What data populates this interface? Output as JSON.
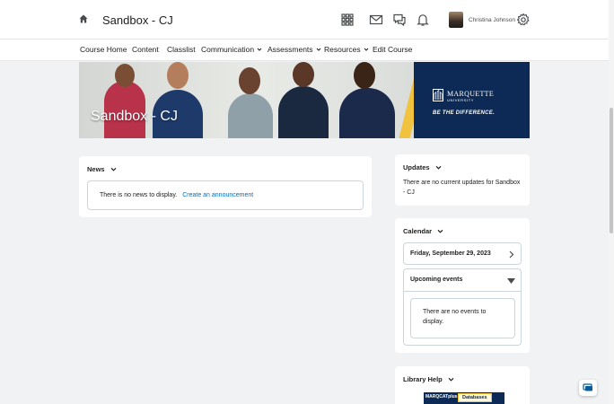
{
  "header": {
    "site_title": "Sandbox - CJ",
    "user_name": "Christina Johnson",
    "icons": [
      "home-icon",
      "waffle-icon",
      "email-icon",
      "discussions-icon",
      "notifications-icon",
      "settings-icon"
    ]
  },
  "nav": {
    "items": [
      {
        "label": "Course Home",
        "dropdown": false
      },
      {
        "label": "Content",
        "dropdown": false
      },
      {
        "label": "Classlist",
        "dropdown": false
      },
      {
        "label": "Communication",
        "dropdown": true
      },
      {
        "label": "Assessments",
        "dropdown": true
      },
      {
        "label": "Resources",
        "dropdown": true
      },
      {
        "label": "Edit Course",
        "dropdown": false
      }
    ]
  },
  "banner": {
    "title": "Sandbox - CJ",
    "logo_name": "MARQUETTE",
    "logo_sub": "UNIVERSITY",
    "tagline": "BE THE DIFFERENCE."
  },
  "news": {
    "heading": "News",
    "empty_text": "There is no news to display.",
    "create_link": "Create an announcement"
  },
  "updates": {
    "heading": "Updates",
    "text": "There are no current updates for Sandbox - CJ"
  },
  "calendar": {
    "heading": "Calendar",
    "date": "Friday, September 29, 2023",
    "upcoming_heading": "Upcoming events",
    "empty_text": "There are no events to display."
  },
  "library": {
    "heading": "Library Help",
    "thumb_left": "MARQCATplus",
    "thumb_right": "Databases"
  },
  "colors": {
    "link": "#006fbf",
    "marquette_blue": "#0c2a55",
    "marquette_gold": "#f0c23e",
    "page_bg": "#f1f2f4"
  }
}
